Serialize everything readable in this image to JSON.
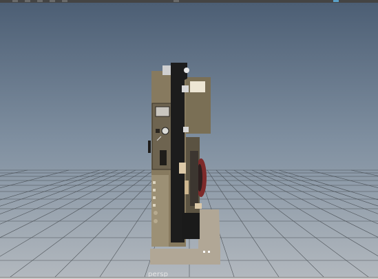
{
  "viewport": {
    "camera_label": "persp",
    "background_top": "#4c5e74",
    "background_bottom": "#b2b8be",
    "grid_color": "#3d4247"
  },
  "toolbar": {
    "icons": [
      "snap-icon",
      "snap-icon",
      "snap-icon",
      "snap-icon",
      "snap-icon",
      "render-icon",
      "camera-icon"
    ]
  },
  "model": {
    "body_color": "#877a5f",
    "belt_color": "#1c1c1c",
    "base_color": "#b1a796",
    "reel_color": "#7e2a2a"
  }
}
